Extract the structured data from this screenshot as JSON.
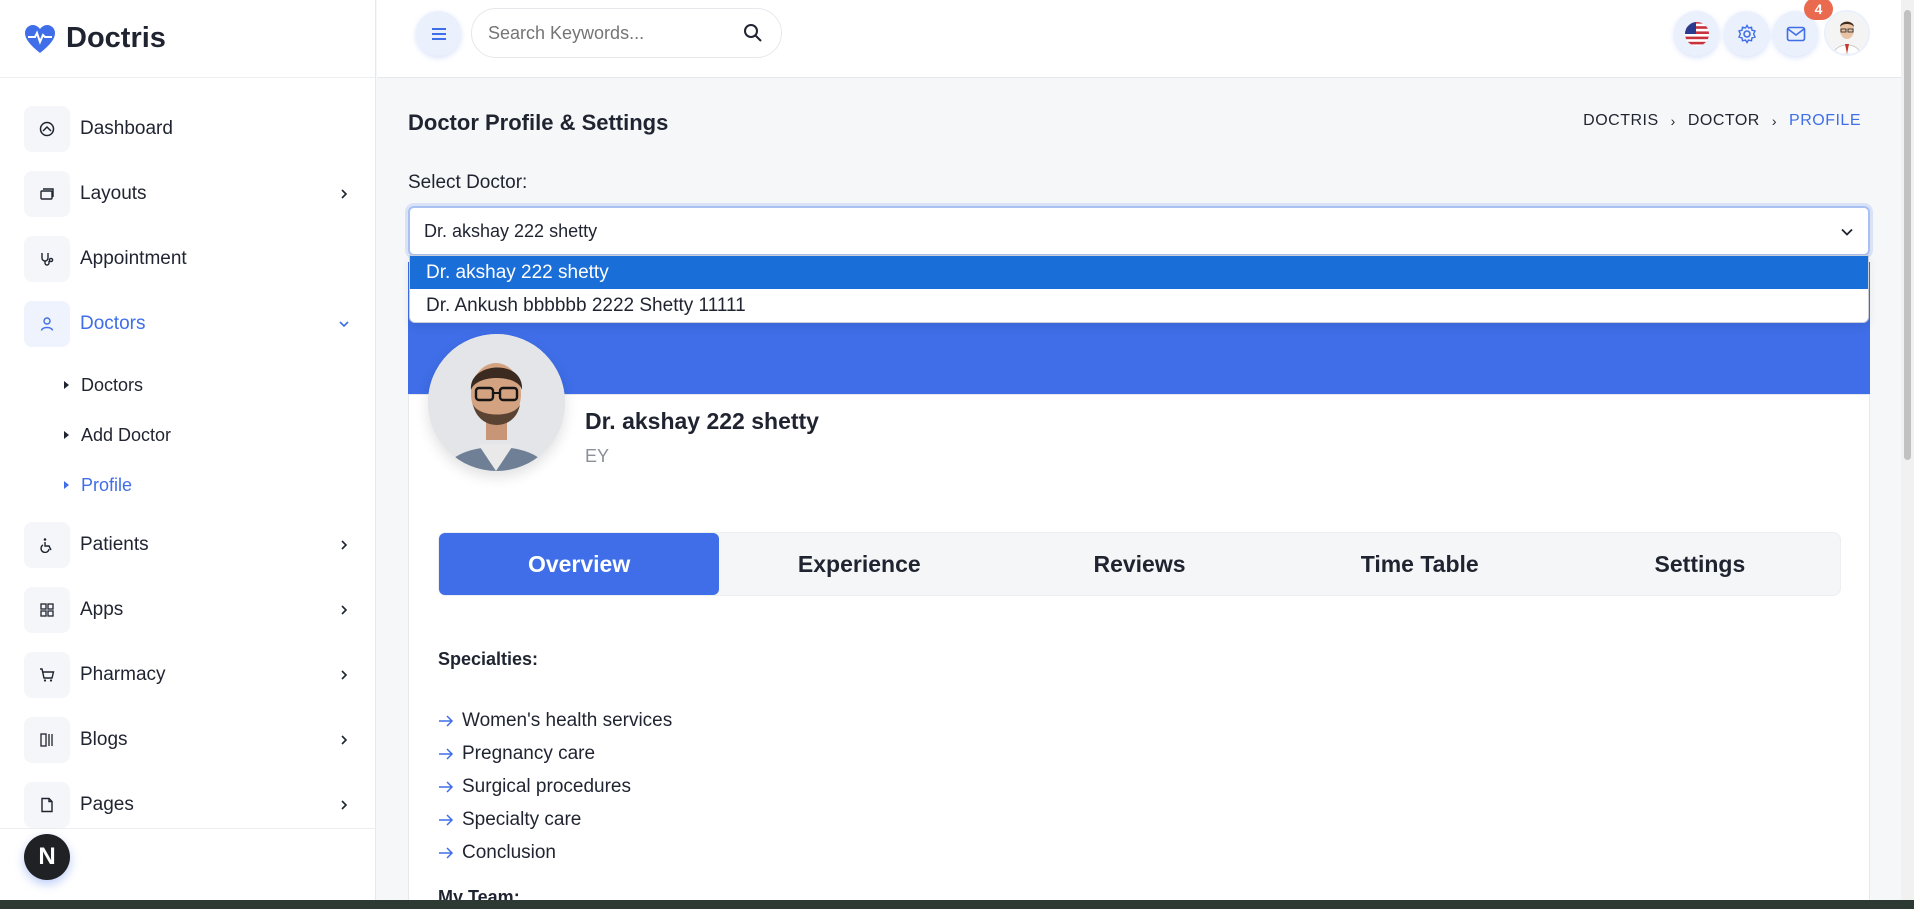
{
  "brand": {
    "name": "Doctris"
  },
  "sidebar": {
    "items": [
      {
        "label": "Dashboard",
        "icon": "dashboard-icon"
      },
      {
        "label": "Layouts",
        "icon": "layouts-icon"
      },
      {
        "label": "Appointment",
        "icon": "stethoscope-icon"
      },
      {
        "label": "Doctors",
        "icon": "user-icon"
      },
      {
        "label": "Patients",
        "icon": "wheelchair-icon"
      },
      {
        "label": "Apps",
        "icon": "grid-icon"
      },
      {
        "label": "Pharmacy",
        "icon": "cart-icon"
      },
      {
        "label": "Blogs",
        "icon": "blog-icon"
      },
      {
        "label": "Pages",
        "icon": "file-icon"
      }
    ],
    "doctors_sub": [
      "Doctors",
      "Add Doctor",
      "Profile"
    ],
    "footer_badge": "N"
  },
  "topbar": {
    "search_placeholder": "Search Keywords...",
    "notification_count": "4"
  },
  "page": {
    "title": "Doctor Profile & Settings",
    "breadcrumb": [
      "DOCTRIS",
      "DOCTOR",
      "PROFILE"
    ],
    "select_label": "Select Doctor:",
    "selected_doctor": "Dr. akshay 222 shetty",
    "options": [
      "Dr. akshay 222 shetty",
      "Dr. Ankush bbbbbb 2222 Shetty 11111"
    ]
  },
  "profile": {
    "name": "Dr. akshay 222 shetty",
    "subtitle": "EY"
  },
  "tabs": [
    "Overview",
    "Experience",
    "Reviews",
    "Time Table",
    "Settings"
  ],
  "overview": {
    "specialties_title": "Specialties:",
    "specialties": [
      "Women's health services",
      "Pregnancy care",
      "Surgical procedures",
      "Specialty care",
      "Conclusion"
    ],
    "team_title": "My Team:"
  },
  "colors": {
    "accent": "#3f6ee8",
    "selected_option": "#1a6ed8",
    "badge": "#ea6a4f"
  }
}
